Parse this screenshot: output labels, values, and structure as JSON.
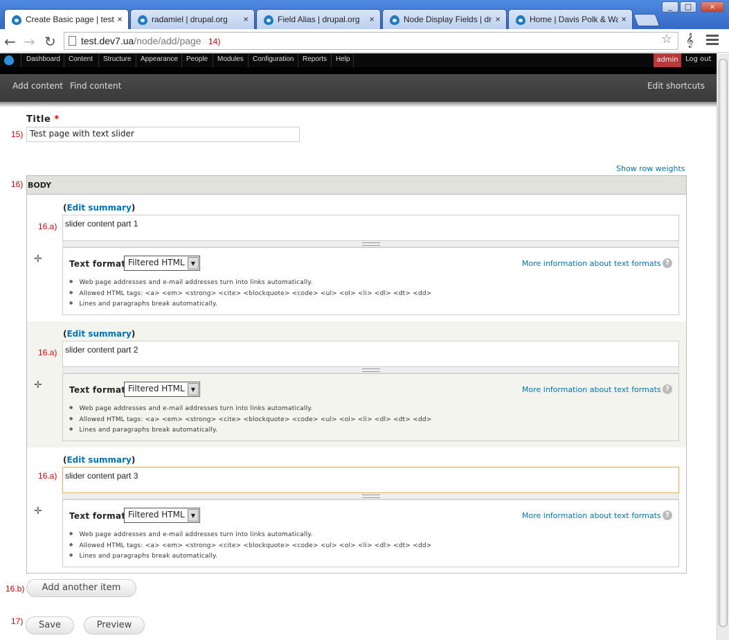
{
  "browser": {
    "tabs": [
      {
        "label": "Create Basic page | test.d"
      },
      {
        "label": "radamiel | drupal.org"
      },
      {
        "label": "Field Alias | drupal.org"
      },
      {
        "label": "Node Display Fields | drupa"
      },
      {
        "label": "Home | Davis Polk & Wardw"
      }
    ],
    "tab_close": "×",
    "url_host": "test.dev7.ua",
    "url_path": "/node/add/page",
    "window_buttons": [
      "_",
      "□",
      "×"
    ]
  },
  "admin_menu": {
    "items": [
      "Dashboard",
      "Content",
      "Structure",
      "Appearance",
      "People",
      "Modules",
      "Configuration",
      "Reports",
      "Help"
    ],
    "user": "admin",
    "logout": "Log out"
  },
  "shortcuts": {
    "add_content": "Add content",
    "find_content": "Find content",
    "edit_shortcuts": "Edit shortcuts"
  },
  "annotations": {
    "url": "14)",
    "title": "15)",
    "body": "16)",
    "row1": "16.a)",
    "row2": "16.a)",
    "row3": "16.a)",
    "add_item": "16.b)",
    "save": "17)"
  },
  "form": {
    "title_label": "Title",
    "required_mark": "*",
    "title_value": "Test page with text slider",
    "show_row_weights": "Show row weights",
    "body_header": "BODY",
    "edit_summary": "Edit summary",
    "rows": [
      {
        "value": "slider content part 1"
      },
      {
        "value": "slider content part 2"
      },
      {
        "value": "slider content part 3"
      }
    ],
    "text_format_label": "Text format",
    "text_format_value": "Filtered HTML",
    "more_info": "More information about text formats",
    "tips": [
      "Web page addresses and e-mail addresses turn into links automatically.",
      "Allowed HTML tags: <a> <em> <strong> <cite> <blockquote> <code> <ul> <ol> <li> <dl> <dt> <dd>",
      "Lines and paragraphs break automatically."
    ],
    "add_another": "Add another item",
    "save": "Save",
    "preview": "Preview"
  }
}
